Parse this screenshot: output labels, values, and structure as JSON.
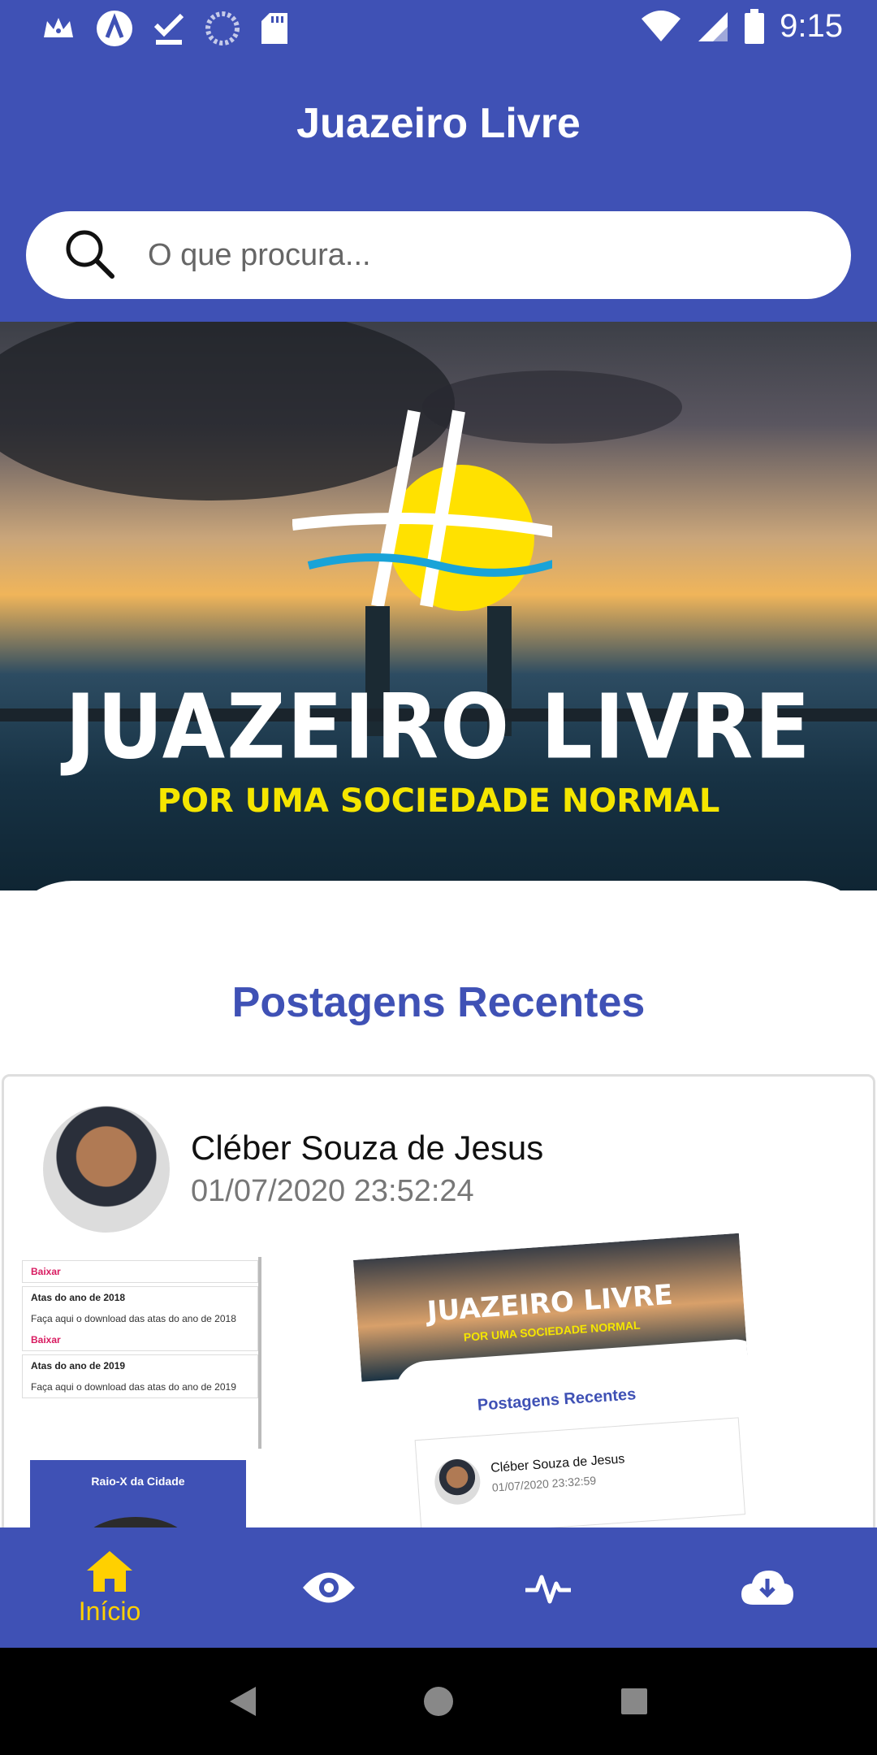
{
  "status_bar": {
    "time": "9:15",
    "left_icons": [
      "crown-icon",
      "app-a-icon",
      "download-done-icon",
      "sync-icon",
      "sd-card-icon"
    ],
    "right_icons": [
      "wifi-icon",
      "signal-icon",
      "battery-icon"
    ]
  },
  "app": {
    "title": "Juazeiro Livre",
    "accent_color": "#3f51b5",
    "highlight_color": "#ffd000"
  },
  "search": {
    "placeholder": "O que procura..."
  },
  "hero": {
    "logo_text": "JUAZEIRO LIVRE",
    "tagline": "POR UMA SOCIEDADE NORMAL"
  },
  "section": {
    "title": "Postagens Recentes"
  },
  "post": {
    "author": "Cléber Souza de Jesus",
    "datetime": "01/07/2020 23:52:24",
    "image_left": {
      "link1": "Baixar",
      "heading1": "Atas do ano de 2018",
      "text1": "Faça aqui o download das atas do ano de 2018",
      "link2": "Baixar",
      "heading2": "Atas do ano de 2019",
      "text2": "Faça aqui o download das atas do ano de 2019",
      "subscreen_title": "Raio-X da Cidade"
    },
    "image_right": {
      "logo_text": "JUAZEIRO LIVRE",
      "tagline": "POR UMA SOCIEDADE NORMAL",
      "section_title": "Postagens Recentes",
      "author": "Cléber Souza de Jesus",
      "datetime": "01/07/2020 23:32:59"
    }
  },
  "bottom_nav": {
    "items": [
      {
        "icon": "home-icon",
        "label": "Início",
        "active": true
      },
      {
        "icon": "eye-icon",
        "label": "",
        "active": false
      },
      {
        "icon": "pulse-icon",
        "label": "",
        "active": false
      },
      {
        "icon": "cloud-download-icon",
        "label": "",
        "active": false
      }
    ]
  },
  "system_nav": [
    "back-icon",
    "home-circle-icon",
    "recents-icon"
  ]
}
